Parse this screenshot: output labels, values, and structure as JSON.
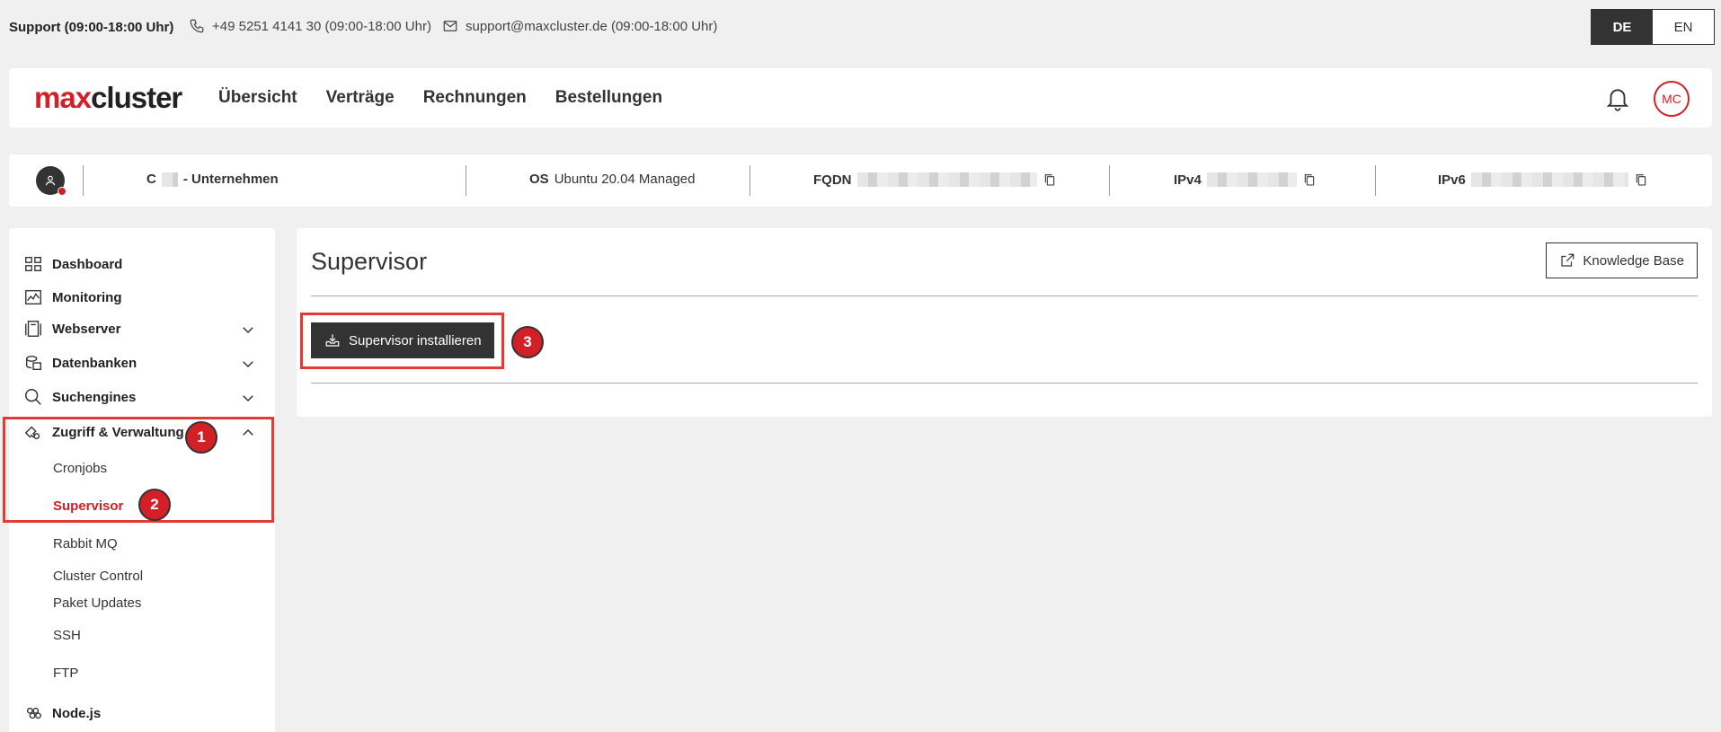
{
  "topbar": {
    "support_label": "Support (09:00-18:00 Uhr)",
    "phone": "+49 5251 4141 30 (09:00-18:00 Uhr)",
    "email": "support@maxcluster.de (09:00-18:00 Uhr)",
    "lang": {
      "de": "DE",
      "en": "EN",
      "active": "DE"
    }
  },
  "header": {
    "logo_max": "max",
    "logo_cluster": "cluster",
    "nav": [
      "Übersicht",
      "Verträge",
      "Rechnungen",
      "Bestellungen"
    ],
    "avatar_initials": "MC"
  },
  "infobar": {
    "company_prefix": "C",
    "company_suffix": " - Unternehmen",
    "os_label": "OS",
    "os_value": "Ubuntu 20.04 Managed",
    "fqdn_label": "FQDN",
    "ipv4_label": "IPv4",
    "ipv6_label": "IPv6"
  },
  "sidebar": {
    "items": [
      {
        "label": "Dashboard",
        "icon": "dashboard-icon"
      },
      {
        "label": "Monitoring",
        "icon": "monitoring-icon"
      },
      {
        "label": "Webserver",
        "icon": "webserver-icon",
        "expandable": true
      },
      {
        "label": "Datenbanken",
        "icon": "database-icon",
        "expandable": true
      },
      {
        "label": "Suchengines",
        "icon": "search-icon",
        "expandable": true
      },
      {
        "label": "Zugriff & Verwaltung",
        "icon": "key-icon",
        "expanded": true
      },
      {
        "label": "Node.js",
        "icon": "nodejs-icon"
      }
    ],
    "subitems": [
      "Cronjobs",
      "Supervisor",
      "Rabbit MQ",
      "Cluster Control",
      "Paket Updates",
      "SSH",
      "FTP"
    ],
    "active_subitem": "Supervisor"
  },
  "main": {
    "title": "Supervisor",
    "kb_label": "Knowledge Base",
    "install_label": "Supervisor installieren"
  },
  "annotations": {
    "badge1": "1",
    "badge2": "2",
    "badge3": "3",
    "highlight_color": "#e53935"
  },
  "colors": {
    "brand_red": "#d32027",
    "dark": "#333333",
    "background": "#f0f0f0"
  }
}
